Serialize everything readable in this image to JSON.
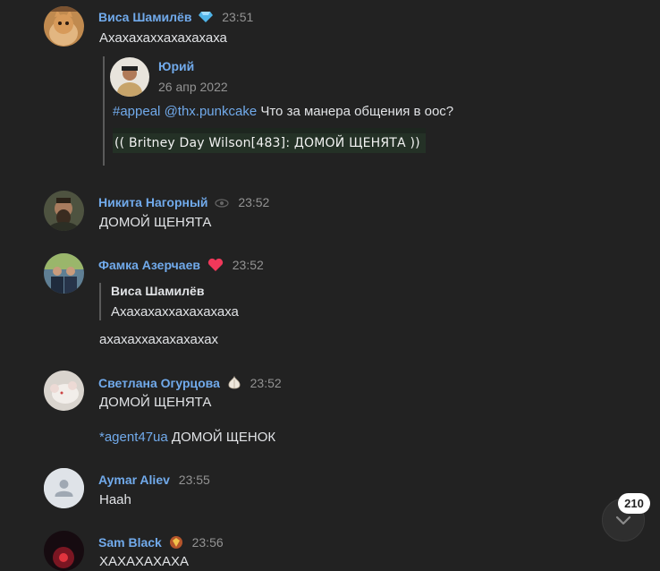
{
  "messages": [
    {
      "author": "Виса Шамилёв",
      "time": "23:51",
      "badge_icon": "gem-icon",
      "text": "Ахахахаххахахахаха",
      "forward": {
        "author": "Юрий",
        "date": "26 апр 2022",
        "hashtag": "#appeal",
        "mention": "@thx.punkcake",
        "text": "Что за манера общения в оос?",
        "image_caption": "(( Britney Day Wilson[483]: ДОМОЙ ЩЕНЯТА ))"
      }
    },
    {
      "author": "Никита Нагорный",
      "time": "23:52",
      "badge_icon": "eye-icon",
      "text": "ДОМОЙ ЩЕНЯТА"
    },
    {
      "author": "Фамка Азерчаев",
      "time": "23:52",
      "badge_icon": "heart-icon",
      "reply": {
        "author": "Виса Шамилёв",
        "text": "Ахахахаххахахахаха"
      },
      "text": "ахахаххахахахахах"
    },
    {
      "author": "Светлана Огурцова",
      "time": "23:52",
      "badge_icon": "garlic-icon",
      "text": "ДОМОЙ ЩЕНЯТА",
      "text2_link": "*agent47ua",
      "text2": "ДОМОЙ ЩЕНОК"
    },
    {
      "author": "Aymar Aliev",
      "time": "23:55",
      "text": "Haah"
    },
    {
      "author": "Sam Black",
      "time": "23:56",
      "badge_icon": "shield-icon",
      "text": "ХАХАХАХАХА"
    }
  ],
  "unread_count": "210",
  "colors": {
    "background": "#222222",
    "name": "#71aaeb",
    "time": "#939393"
  }
}
